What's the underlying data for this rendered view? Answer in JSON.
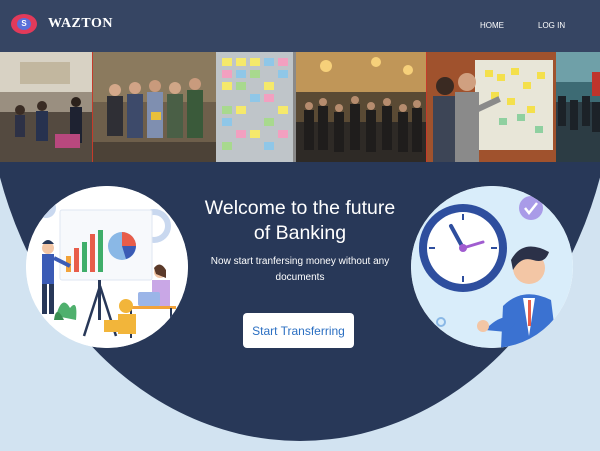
{
  "navbar": {
    "brand": "WAZTON",
    "logo_letter": "S",
    "links": [
      {
        "label": "HOME"
      },
      {
        "label": "LOG IN"
      }
    ]
  },
  "photo_strip": {
    "icons": [
      "office-lounge-photo",
      "team-group-photo",
      "sticky-notes-photo",
      "crowd-hall-photo",
      "whiteboard-meeting-photo",
      "audience-photo"
    ]
  },
  "hero": {
    "title_line1": "Welcome to the future",
    "title_line2": "of Banking",
    "subtitle": "Now start tranfersing money without any documents",
    "cta_label": "Start Transferring"
  },
  "colors": {
    "navbar": "#364563",
    "hero_dark": "#283858",
    "page_light": "#d2e3f1",
    "button_text": "#2b6fc2"
  }
}
